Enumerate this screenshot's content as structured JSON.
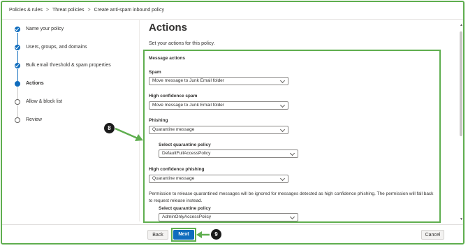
{
  "breadcrumb": [
    "Policies & rules",
    "Threat policies",
    "Create anti-spam inbound policy"
  ],
  "breadcrumb_sep": ">",
  "steps": [
    {
      "label": "Name your policy",
      "state": "done"
    },
    {
      "label": "Users, groups, and domains",
      "state": "done"
    },
    {
      "label": "Bulk email threshold & spam properties",
      "state": "done"
    },
    {
      "label": "Actions",
      "state": "current"
    },
    {
      "label": "Allow & block list",
      "state": "todo"
    },
    {
      "label": "Review",
      "state": "todo"
    }
  ],
  "page": {
    "title": "Actions",
    "subtitle": "Set your actions for this policy.",
    "section_title": "Message actions"
  },
  "fields": {
    "spam": {
      "label": "Spam",
      "value": "Move message to Junk Email folder"
    },
    "hc_spam": {
      "label": "High confidence spam",
      "value": "Move message to Junk Email folder"
    },
    "phishing": {
      "label": "Phishing",
      "value": "Quarantine message"
    },
    "phishing_quarantine": {
      "label": "Select quarantine policy",
      "value": "DefaultFullAccessPolicy"
    },
    "hc_phishing": {
      "label": "High confidence phishing",
      "value": "Quarantine message"
    },
    "hc_phishing_note": "Permission to release quarantined messages will be ignored for messages detected as high confidence phishing. The permission will fall back to request release instead.",
    "hc_phishing_quarantine": {
      "label": "Select quarantine policy",
      "value": "AdminOnlyAccessPolicy"
    }
  },
  "footer": {
    "back": "Back",
    "next": "Next",
    "cancel": "Cancel"
  },
  "annotations": {
    "badge_a": "8",
    "badge_b": "9"
  },
  "colors": {
    "accent": "#0f6cbd",
    "highlight": "#5fae4f"
  }
}
